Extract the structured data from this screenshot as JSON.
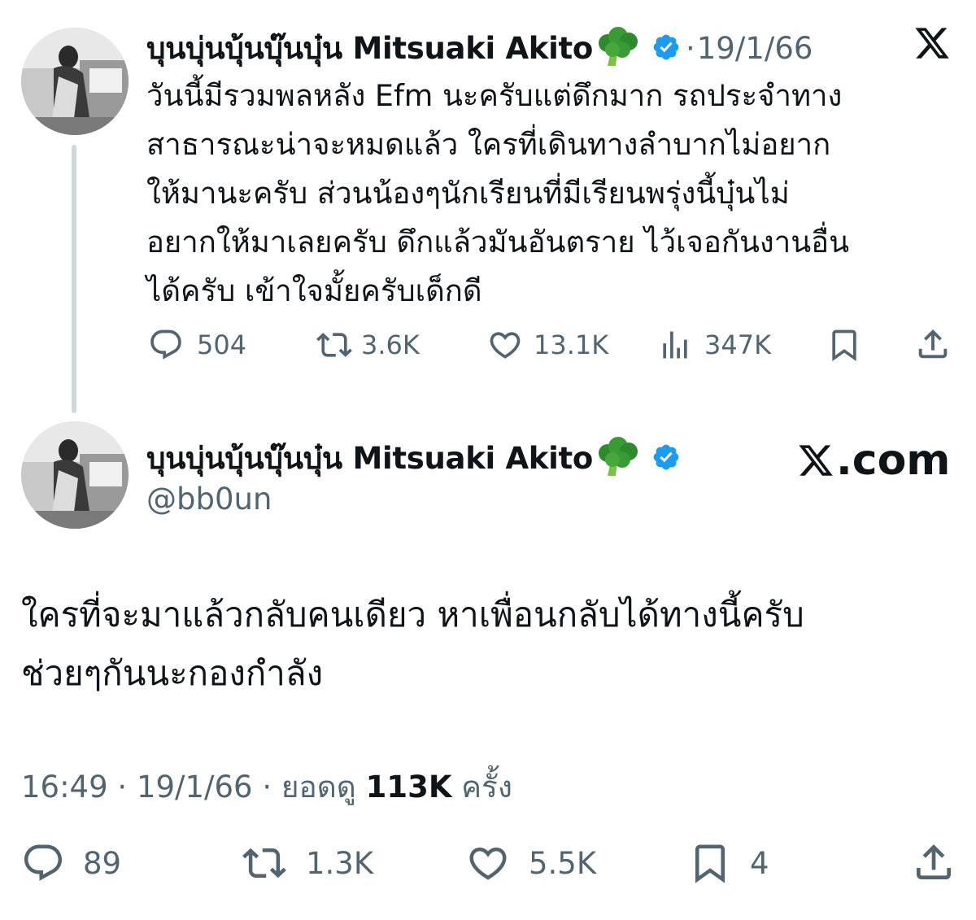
{
  "quoted_tweet": {
    "display_name": "บุนบุ่นบุ้นบุ๊นบุ๋น Mitsuaki Akito",
    "emoji_icon": "broccoli-icon",
    "verified": true,
    "separator": "·",
    "date": "19/1/66",
    "text_lines": [
      "วันนี้มีรวมพลหลัง Efm นะครับแต่ดึกมาก รถประจำทาง",
      "สาธารณะน่าจะหมดแล้ว ใครที่เดินทางลำบากไม่อยาก",
      "ให้มานะครับ ส่วนน้องๆนักเรียนที่มีเรียนพรุ่งนี้บุ๋นไม่",
      "อยากให้มาเลยครับ ดึกแล้วมันอันตราย ไว้เจอกันงานอื่น",
      "ได้ครับ เข้าใจมั้ยครับเด็กดี"
    ],
    "actions": {
      "replies": "504",
      "retweets": "3.6K",
      "likes": "13.1K",
      "views": "347K"
    }
  },
  "main_tweet": {
    "display_name": "บุนบุ่นบุ้นบุ๊นบุ๋น Mitsuaki Akito",
    "emoji_icon": "broccoli-icon",
    "verified": true,
    "handle": "@bb0un",
    "watermark": ".com",
    "text_lines": [
      "ใครที่จะมาแล้วกลับคนเดียว หาเพื่อนกลับได้ทางนี้ครับ",
      "ช่วยๆกันนะกองกำลัง"
    ],
    "time": "16:49",
    "date": "19/1/66",
    "views_label": "ยอดดู",
    "views_count": "113K",
    "views_suffix": "ครั้ง",
    "separator": "·",
    "actions": {
      "replies": "89",
      "retweets": "1.3K",
      "likes": "5.5K",
      "bookmarks": "4"
    }
  },
  "colors": {
    "text": "#0f1419",
    "secondary": "#536471",
    "verified_blue": "#1d9bf0",
    "thread_line": "#cfd9de"
  }
}
